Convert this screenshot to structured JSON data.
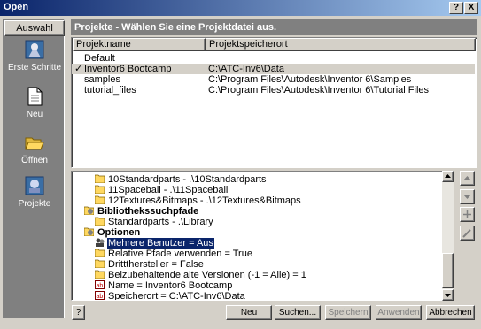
{
  "window": {
    "title": "Open",
    "help_glyph": "?",
    "close_glyph": "X"
  },
  "sidebar": {
    "header_label": "Auswahl",
    "items": [
      {
        "label": "Erste Schritte",
        "icon": "first-steps-icon"
      },
      {
        "label": "Neu",
        "icon": "new-document-icon"
      },
      {
        "label": "Öffnen",
        "icon": "open-folder-icon"
      },
      {
        "label": "Projekte",
        "icon": "projects-icon"
      }
    ]
  },
  "projects": {
    "header": "Projekte - Wählen Sie eine Projektdatei aus.",
    "columns": [
      "Projektname",
      "Projektspeicherort"
    ],
    "rows": [
      {
        "name": "Default",
        "location": ""
      },
      {
        "name": "Inventor6 Bootcamp",
        "location": "C:\\ATC-Inv6\\Data",
        "active": true
      },
      {
        "name": "samples",
        "location": "C:\\Program Files\\Autodesk\\Inventor 6\\Samples"
      },
      {
        "name": "tutorial_files",
        "location": "C:\\Program Files\\Autodesk\\Inventor 6\\Tutorial Files"
      }
    ],
    "active_mark": "✓"
  },
  "tree": {
    "items": [
      {
        "text": "10Standardparts - .\\10Standardparts",
        "icon": "folder-icon"
      },
      {
        "text": "11Spaceball - .\\11Spaceball",
        "icon": "folder-icon"
      },
      {
        "text": "12Textures&Bitmaps - .\\12Textures&Bitmaps",
        "icon": "folder-icon"
      },
      {
        "text": "Bibliothekssuchpfade",
        "icon": "folder-group-icon",
        "bold": true
      },
      {
        "text": "Standardparts - .\\Library",
        "icon": "folder-icon"
      },
      {
        "text": "Optionen",
        "icon": "folder-group-icon",
        "bold": true
      },
      {
        "text": "Mehrere Benutzer = Aus",
        "icon": "users-icon",
        "selected": true
      },
      {
        "text": "Relative Pfade verwenden = True",
        "icon": "folder-icon"
      },
      {
        "text": "Drittthersteller = False",
        "icon": "folder-icon"
      },
      {
        "text": "Beizubehaltende alte Versionen (-1 = Alle) = 1",
        "icon": "folder-icon"
      },
      {
        "text": "Name = Inventor6 Bootcamp",
        "icon": "text-field-icon"
      },
      {
        "text": "Speicherort = C:\\ATC-Inv6\\Data",
        "icon": "text-field-icon"
      }
    ]
  },
  "buttons": {
    "help": "?",
    "neu": "Neu",
    "suchen": "Suchen...",
    "speichern": "Speichern",
    "anwenden": "Anwenden",
    "abbrechen": "Abbrechen"
  },
  "colors": {
    "title_bar": "#0a246a",
    "selection": "#0a246a",
    "panel_header": "#808080",
    "face": "#d4d0c8"
  }
}
